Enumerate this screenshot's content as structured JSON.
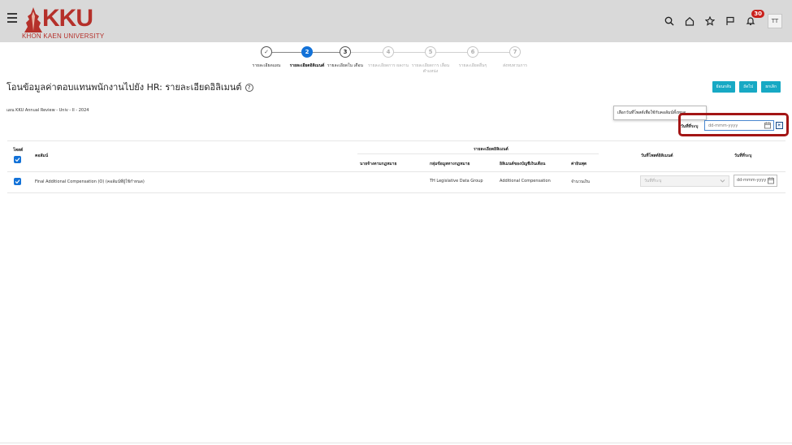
{
  "header": {
    "logo_text": "KKU",
    "logo_sub": "KHON KAEN UNIVERSITY",
    "notification_count": "30",
    "avatar_initials": "TT"
  },
  "stepper": {
    "steps": [
      {
        "number": "✓",
        "label": "รายละเอียดแผน"
      },
      {
        "number": "2",
        "label": "รายละเอียดอิลิเมนต์"
      },
      {
        "number": "3",
        "label": "รายละเอียดใน เดือน"
      },
      {
        "number": "4",
        "label": "รายละเอียดการ ผลงาน"
      },
      {
        "number": "5",
        "label": "รายละเอียดการ เลื่อนตำแหน่ง"
      },
      {
        "number": "6",
        "label": "รายละเอียดอื่นๆ"
      },
      {
        "number": "7",
        "label": "ส่งทบทวนการ"
      }
    ]
  },
  "page": {
    "title": "โอนข้อมูลค่าตอบแทนพนักงานไปยัง HR: รายละเอียดอิลิเมนต์",
    "plan_prefix": "แผน",
    "plan_name": "KKU Annual Review - Univ - II - 2024"
  },
  "buttons": {
    "back": "ย้อนกลับ",
    "next": "ถัดไป",
    "cancel": "ยกเลิก"
  },
  "date_filter": {
    "tooltip": "เลือกวันที่โพสต์เพื่อใช้กับคอลัมน์ทั้งหมด",
    "label": "วันที่ที่ระบุ",
    "placeholder": "dd-mmm-yyyy",
    "apply_icon": "▸"
  },
  "table": {
    "headers": {
      "post": "โพสต์",
      "column": "คอลัมน์",
      "element_details": "รายละเอียดอิลิเมนต์",
      "employer": "นายจ้างตามกฎหมาย",
      "data_group": "กลุ่มข้อมูลทางกฎหมาย",
      "element": "อิลิเมนต์ของบัญชีเงินเดือน",
      "input_value": "ค่าอินพุต",
      "element_post_date": "วันที่โพสต์อิลิเมนต์",
      "specified_date": "วันที่ที่ระบุ"
    },
    "rows": [
      {
        "column": "Final Additional Compensation (O) (คอลัมน์ที่ผู้ใช้กำหนด)",
        "employer": "",
        "data_group": "TH Legislative Data Group",
        "element": "Additional Compensation",
        "input_value": "จำนวนเงิน",
        "post_date_select": "วันที่ที่ระบุ",
        "specified_date": "dd-mmm-yyyy"
      }
    ]
  },
  "colors": {
    "primary_blue": "#1372d8",
    "button_teal": "#17a9c4",
    "highlight_red": "#a31515",
    "brand_red": "#b5302a"
  }
}
